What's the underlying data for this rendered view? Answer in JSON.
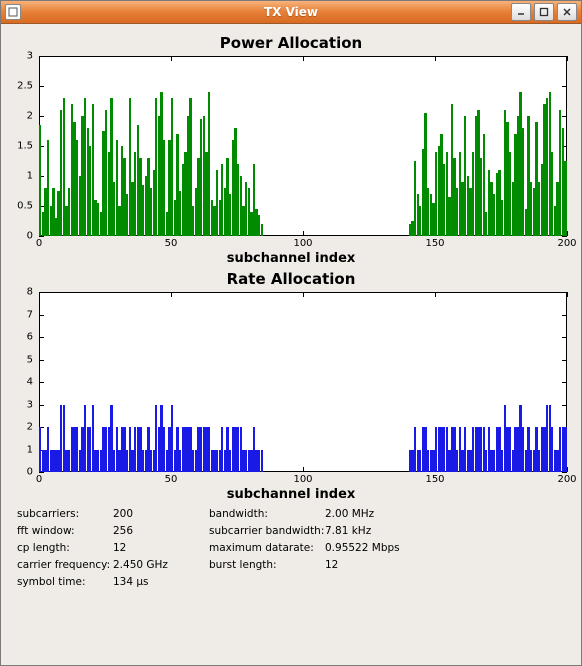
{
  "window": {
    "title": "TX View"
  },
  "chart_data": [
    {
      "type": "bar",
      "title": "Power Allocation",
      "xlabel": "subchannel index",
      "ylabel": "",
      "xlim": [
        0,
        200
      ],
      "ylim": [
        0,
        3
      ],
      "xticks": [
        0,
        50,
        100,
        150,
        200
      ],
      "yticks": [
        0,
        0.5,
        1,
        1.5,
        2,
        2.5,
        3
      ],
      "color": "#008b00",
      "x": [
        0,
        1,
        2,
        3,
        4,
        5,
        6,
        7,
        8,
        9,
        10,
        11,
        12,
        13,
        14,
        15,
        16,
        17,
        18,
        19,
        20,
        21,
        22,
        23,
        24,
        25,
        26,
        27,
        28,
        29,
        30,
        31,
        32,
        33,
        34,
        35,
        36,
        37,
        38,
        39,
        40,
        41,
        42,
        43,
        44,
        45,
        46,
        47,
        48,
        49,
        50,
        51,
        52,
        53,
        54,
        55,
        56,
        57,
        58,
        59,
        60,
        61,
        62,
        63,
        64,
        65,
        66,
        67,
        68,
        69,
        70,
        71,
        72,
        73,
        74,
        75,
        76,
        77,
        78,
        79,
        80,
        81,
        82,
        83,
        84,
        140,
        141,
        142,
        143,
        144,
        145,
        146,
        147,
        148,
        149,
        150,
        151,
        152,
        153,
        154,
        155,
        156,
        157,
        158,
        159,
        160,
        161,
        162,
        163,
        164,
        165,
        166,
        167,
        168,
        169,
        170,
        171,
        172,
        173,
        174,
        175,
        176,
        177,
        178,
        179,
        180,
        181,
        182,
        183,
        184,
        185,
        186,
        187,
        188,
        189,
        190,
        191,
        192,
        193,
        194,
        195,
        196,
        197,
        198,
        199
      ],
      "values": [
        1.85,
        0.4,
        0.8,
        1.6,
        0.5,
        0.8,
        0.3,
        0.75,
        2.1,
        2.3,
        0.5,
        0.8,
        2.2,
        1.9,
        1.6,
        1.0,
        2.0,
        2.3,
        1.8,
        1.5,
        2.2,
        0.6,
        0.55,
        0.4,
        1.75,
        2.1,
        1.4,
        2.3,
        0.9,
        1.6,
        0.5,
        1.5,
        1.3,
        0.7,
        2.3,
        0.9,
        1.4,
        1.85,
        1.3,
        0.85,
        1.0,
        1.3,
        0.8,
        1.1,
        2.3,
        2.0,
        2.4,
        1.6,
        0.4,
        1.6,
        2.3,
        0.6,
        1.7,
        0.75,
        1.2,
        1.4,
        2.0,
        2.3,
        0.5,
        0.8,
        1.3,
        1.95,
        2.0,
        1.4,
        2.4,
        0.6,
        0.5,
        1.1,
        0.6,
        1.2,
        0.8,
        1.3,
        0.7,
        1.6,
        1.8,
        1.2,
        1.0,
        0.5,
        0.9,
        0.8,
        0.4,
        1.2,
        0.45,
        0.35,
        0.2,
        0.2,
        0.25,
        1.25,
        0.7,
        0.5,
        1.45,
        2.05,
        0.8,
        0.7,
        0.55,
        1.4,
        1.5,
        1.7,
        1.2,
        1.4,
        0.65,
        2.2,
        1.3,
        0.8,
        1.4,
        0.9,
        2.0,
        1.0,
        0.8,
        1.4,
        2.0,
        2.1,
        1.3,
        1.7,
        0.4,
        1.1,
        0.9,
        0.7,
        1.05,
        1.1,
        0.6,
        2.1,
        1.9,
        1.4,
        0.9,
        1.7,
        2.0,
        2.4,
        1.8,
        0.45,
        2.0,
        0.9,
        0.8,
        1.9,
        0.9,
        1.2,
        2.2,
        2.3,
        2.4,
        1.4,
        0.5,
        0.9,
        2.1,
        1.8,
        1.25
      ]
    },
    {
      "type": "bar",
      "title": "Rate Allocation",
      "xlabel": "subchannel index",
      "ylabel": "",
      "xlim": [
        0,
        200
      ],
      "ylim": [
        0,
        8
      ],
      "xticks": [
        0,
        50,
        100,
        150,
        200
      ],
      "yticks": [
        0,
        1,
        2,
        3,
        4,
        5,
        6,
        7,
        8
      ],
      "color": "#1a1ae6",
      "x": [
        0,
        1,
        2,
        3,
        4,
        5,
        6,
        7,
        8,
        9,
        10,
        11,
        12,
        13,
        14,
        15,
        16,
        17,
        18,
        19,
        20,
        21,
        22,
        23,
        24,
        25,
        26,
        27,
        28,
        29,
        30,
        31,
        32,
        33,
        34,
        35,
        36,
        37,
        38,
        39,
        40,
        41,
        42,
        43,
        44,
        45,
        46,
        47,
        48,
        49,
        50,
        51,
        52,
        53,
        54,
        55,
        56,
        57,
        58,
        59,
        60,
        61,
        62,
        63,
        64,
        65,
        66,
        67,
        68,
        69,
        70,
        71,
        72,
        73,
        74,
        75,
        76,
        77,
        78,
        79,
        80,
        81,
        82,
        83,
        84,
        140,
        141,
        142,
        143,
        144,
        145,
        146,
        147,
        148,
        149,
        150,
        151,
        152,
        153,
        154,
        155,
        156,
        157,
        158,
        159,
        160,
        161,
        162,
        163,
        164,
        165,
        166,
        167,
        168,
        169,
        170,
        171,
        172,
        173,
        174,
        175,
        176,
        177,
        178,
        179,
        180,
        181,
        182,
        183,
        184,
        185,
        186,
        187,
        188,
        189,
        190,
        191,
        192,
        193,
        194,
        195,
        196,
        197,
        198,
        199
      ],
      "values": [
        2,
        1,
        1,
        2,
        1,
        1,
        1,
        1,
        3,
        3,
        1,
        1,
        2,
        2,
        2,
        1,
        2,
        3,
        2,
        2,
        3,
        1,
        1,
        1,
        2,
        2,
        2,
        3,
        1,
        2,
        1,
        2,
        2,
        1,
        2,
        1,
        2,
        2,
        2,
        1,
        1,
        2,
        1,
        1,
        3,
        2,
        3,
        2,
        1,
        2,
        3,
        1,
        2,
        1,
        2,
        2,
        2,
        2,
        1,
        1,
        2,
        2,
        2,
        2,
        2,
        1,
        1,
        1,
        1,
        2,
        1,
        2,
        1,
        2,
        2,
        2,
        2,
        1,
        1,
        1,
        1,
        2,
        1,
        1,
        1,
        1,
        1,
        2,
        1,
        1,
        2,
        2,
        1,
        1,
        1,
        2,
        2,
        2,
        2,
        2,
        1,
        2,
        2,
        1,
        2,
        1,
        2,
        1,
        1,
        2,
        2,
        2,
        2,
        2,
        1,
        2,
        1,
        1,
        2,
        2,
        1,
        3,
        2,
        2,
        1,
        2,
        2,
        3,
        2,
        1,
        2,
        1,
        1,
        2,
        1,
        2,
        2,
        3,
        3,
        2,
        1,
        1,
        2,
        2,
        2
      ]
    }
  ],
  "info": {
    "subcarriers": {
      "label": "subcarriers:",
      "value": "200"
    },
    "fft_window": {
      "label": "fft window:",
      "value": "256"
    },
    "cp_length": {
      "label": "cp length:",
      "value": "12"
    },
    "carrier_freq": {
      "label": "carrier frequency:",
      "value": "2.450 GHz"
    },
    "symbol_time": {
      "label": "symbol time:",
      "value": "134 µs"
    },
    "bandwidth": {
      "label": "bandwidth:",
      "value": "2.00 MHz"
    },
    "subcarrier_bw": {
      "label": "subcarrier bandwidth:",
      "value": "7.81 kHz"
    },
    "max_datarate": {
      "label": "maximum datarate:",
      "value": "0.95522 Mbps"
    },
    "burst_length": {
      "label": "burst length:",
      "value": "12"
    }
  }
}
